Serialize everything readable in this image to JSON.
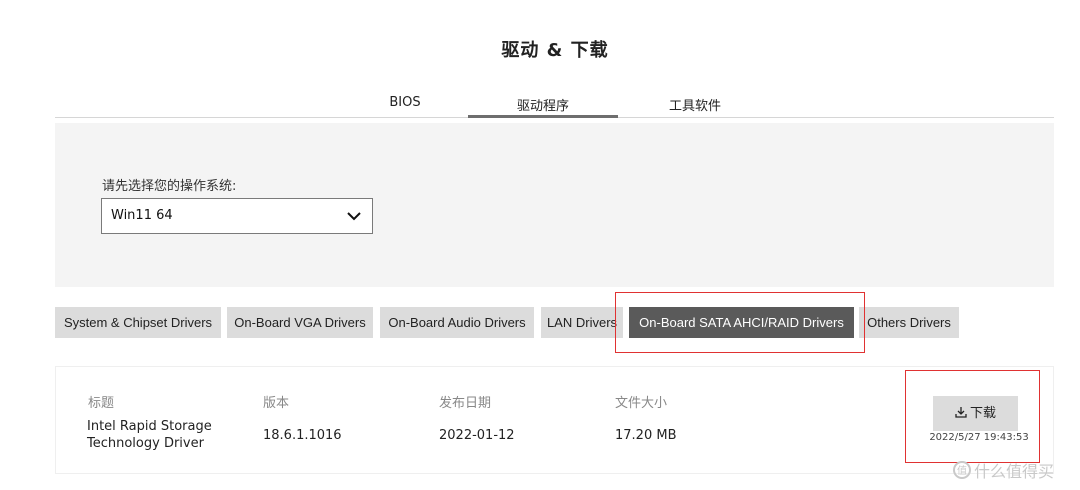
{
  "page": {
    "title": "驱动 & 下载"
  },
  "tabs": [
    {
      "label": "BIOS",
      "active": false
    },
    {
      "label": "驱动程序",
      "active": true
    },
    {
      "label": "工具软件",
      "active": false
    }
  ],
  "os_selector": {
    "label": "请先选择您的操作系统:",
    "value": "Win11 64"
  },
  "categories": [
    {
      "label": "System & Chipset Drivers",
      "active": false
    },
    {
      "label": "On-Board VGA Drivers",
      "active": false
    },
    {
      "label": "On-Board Audio Drivers",
      "active": false
    },
    {
      "label": "LAN Drivers",
      "active": false
    },
    {
      "label": "On-Board SATA AHCI/RAID Drivers",
      "active": true
    },
    {
      "label": "Others Drivers",
      "active": false
    }
  ],
  "driver_table": {
    "headers": {
      "title": "标题",
      "version": "版本",
      "release_date": "发布日期",
      "file_size": "文件大小"
    },
    "row": {
      "title_line1": "Intel Rapid Storage",
      "title_line2": "Technology Driver",
      "version": "18.6.1.1016",
      "release_date": "2022-01-12",
      "file_size": "17.20 MB"
    }
  },
  "download": {
    "label": "下载",
    "timestamp": "2022/5/27 19:43:53",
    "icon": "download-icon"
  },
  "watermark": {
    "text": "什么值得买",
    "icon": "smzdm-logo-icon"
  },
  "colors": {
    "active_category": "#5a5a5a",
    "button": "#dcdcdc",
    "highlight_box": "#e03232",
    "panel": "#f4f4f4"
  }
}
